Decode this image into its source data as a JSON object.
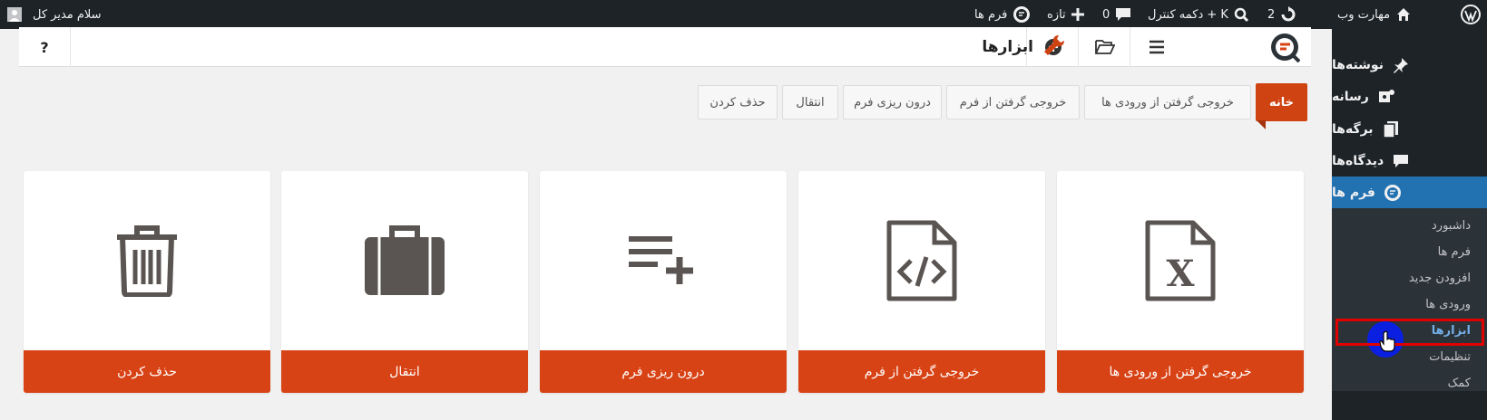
{
  "admin_bar": {
    "site_name": "مهارت وب",
    "updates_count": "2",
    "shortcut": "دکمه کنترل + K",
    "comments_count": "0",
    "new_label": "تازه",
    "forms_label": "فرم ها",
    "greeting": "سلام مدیر کل"
  },
  "sidebar": {
    "items": [
      {
        "label": "نوشته‌ها",
        "icon": "pin-icon"
      },
      {
        "label": "رسانه",
        "icon": "media-icon"
      },
      {
        "label": "برگه‌ها",
        "icon": "pages-icon"
      },
      {
        "label": "دیدگاه‌ها",
        "icon": "comment-icon"
      },
      {
        "label": "فرم ها",
        "icon": "forms-icon"
      }
    ],
    "submenu": [
      "داشبورد",
      "فرم ها",
      "افزودن جدید",
      "ورودی ها",
      "ابزارها",
      "تنظیمات",
      "کمک"
    ],
    "current_submenu": "ابزارها"
  },
  "toolbar": {
    "title": "ابزارها",
    "help": "?"
  },
  "tabs": [
    "خانه",
    "خروجی گرفتن از ورودی ها",
    "خروجی گرفتن از فرم",
    "درون ریزی فرم",
    "انتقال",
    "حذف کردن"
  ],
  "cards": [
    {
      "label": "خروجی گرفتن از ورودی ها",
      "icon": "excel-file-icon"
    },
    {
      "label": "خروجی گرفتن از فرم",
      "icon": "code-file-icon"
    },
    {
      "label": "درون ریزی فرم",
      "icon": "list-add-icon"
    },
    {
      "label": "انتقال",
      "icon": "briefcase-icon"
    },
    {
      "label": "حذف کردن",
      "icon": "trash-icon"
    }
  ],
  "colors": {
    "admin_bg": "#1d2327",
    "accent_blue": "#2271b1",
    "card_footer": "#d84315",
    "active_tab": "#cf4312"
  }
}
